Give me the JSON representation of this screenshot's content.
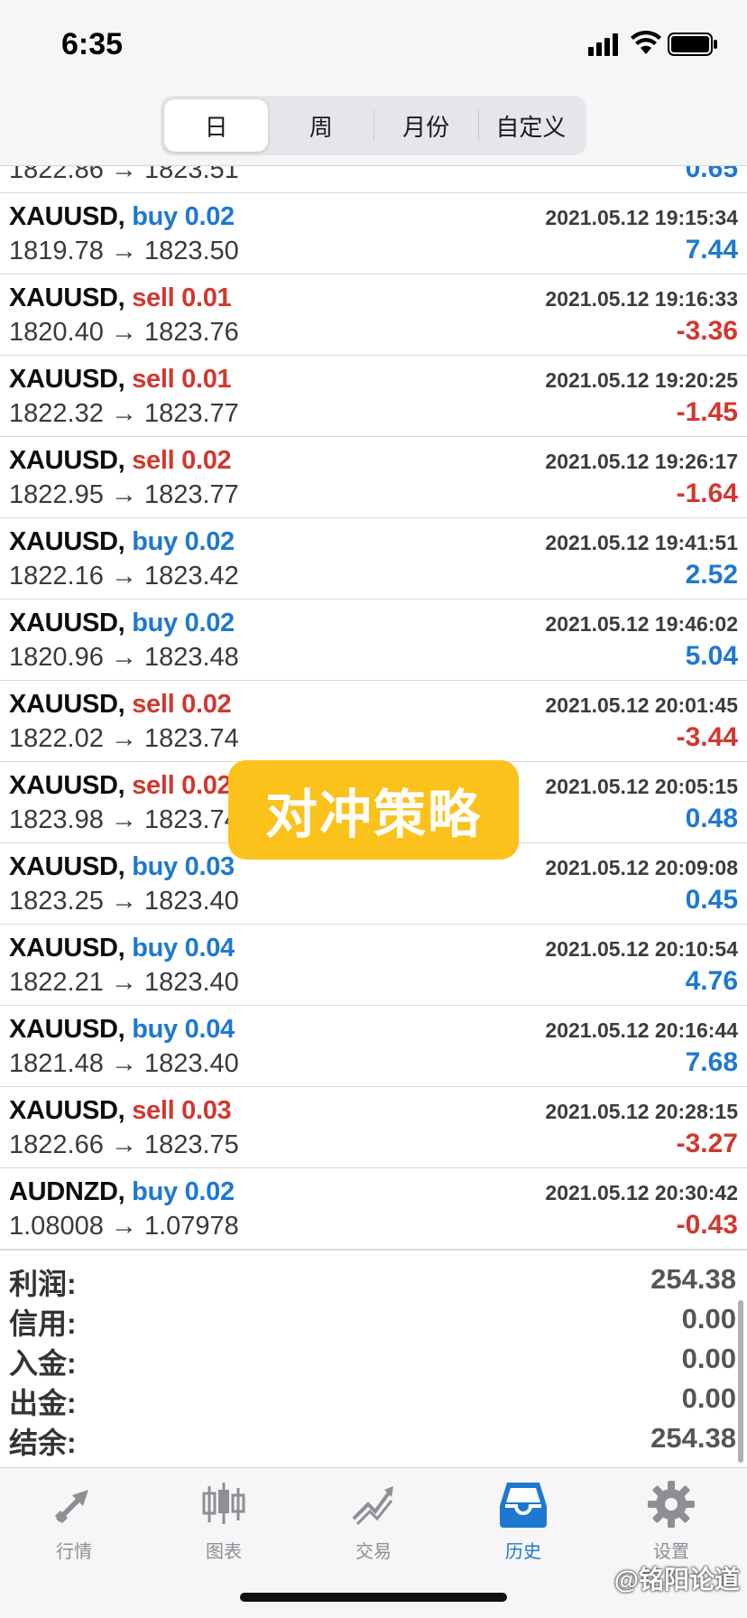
{
  "status": {
    "time": "6:35"
  },
  "periods": [
    "日",
    "周",
    "月份",
    "自定义"
  ],
  "partial_row": {
    "prices": "1822.86 → 1823.51",
    "profit": "0.65"
  },
  "deals": [
    {
      "symbol": "XAUUSD,",
      "side": "buy",
      "volume": "0.02",
      "time": "2021.05.12 19:15:34",
      "prices": "1819.78 → 1823.50",
      "profit": "7.44",
      "sign": "pos"
    },
    {
      "symbol": "XAUUSD,",
      "side": "sell",
      "volume": "0.01",
      "time": "2021.05.12 19:16:33",
      "prices": "1820.40 → 1823.76",
      "profit": "-3.36",
      "sign": "neg"
    },
    {
      "symbol": "XAUUSD,",
      "side": "sell",
      "volume": "0.01",
      "time": "2021.05.12 19:20:25",
      "prices": "1822.32 → 1823.77",
      "profit": "-1.45",
      "sign": "neg"
    },
    {
      "symbol": "XAUUSD,",
      "side": "sell",
      "volume": "0.02",
      "time": "2021.05.12 19:26:17",
      "prices": "1822.95 → 1823.77",
      "profit": "-1.64",
      "sign": "neg"
    },
    {
      "symbol": "XAUUSD,",
      "side": "buy",
      "volume": "0.02",
      "time": "2021.05.12 19:41:51",
      "prices": "1822.16 → 1823.42",
      "profit": "2.52",
      "sign": "pos"
    },
    {
      "symbol": "XAUUSD,",
      "side": "buy",
      "volume": "0.02",
      "time": "2021.05.12 19:46:02",
      "prices": "1820.96 → 1823.48",
      "profit": "5.04",
      "sign": "pos"
    },
    {
      "symbol": "XAUUSD,",
      "side": "sell",
      "volume": "0.02",
      "time": "2021.05.12 20:01:45",
      "prices": "1822.02 → 1823.74",
      "profit": "-3.44",
      "sign": "neg"
    },
    {
      "symbol": "XAUUSD,",
      "side": "sell",
      "volume": "0.02",
      "time": "2021.05.12 20:05:15",
      "prices": "1823.98 → 1823.74",
      "profit": "0.48",
      "sign": "pos"
    },
    {
      "symbol": "XAUUSD,",
      "side": "buy",
      "volume": "0.03",
      "time": "2021.05.12 20:09:08",
      "prices": "1823.25 → 1823.40",
      "profit": "0.45",
      "sign": "pos"
    },
    {
      "symbol": "XAUUSD,",
      "side": "buy",
      "volume": "0.04",
      "time": "2021.05.12 20:10:54",
      "prices": "1822.21 → 1823.40",
      "profit": "4.76",
      "sign": "pos"
    },
    {
      "symbol": "XAUUSD,",
      "side": "buy",
      "volume": "0.04",
      "time": "2021.05.12 20:16:44",
      "prices": "1821.48 → 1823.40",
      "profit": "7.68",
      "sign": "pos"
    },
    {
      "symbol": "XAUUSD,",
      "side": "sell",
      "volume": "0.03",
      "time": "2021.05.12 20:28:15",
      "prices": "1822.66 → 1823.75",
      "profit": "-3.27",
      "sign": "neg"
    },
    {
      "symbol": "AUDNZD,",
      "side": "buy",
      "volume": "0.02",
      "time": "2021.05.12 20:30:42",
      "prices": "1.08008 → 1.07978",
      "profit": "-0.43",
      "sign": "neg"
    }
  ],
  "summary": [
    {
      "label": "利润:",
      "value": "254.38"
    },
    {
      "label": "信用:",
      "value": "0.00"
    },
    {
      "label": "入金:",
      "value": "0.00"
    },
    {
      "label": "出金:",
      "value": "0.00"
    },
    {
      "label": "结余:",
      "value": "254.38"
    }
  ],
  "banner": {
    "text": "对冲策略"
  },
  "tabs": [
    {
      "label": "行情",
      "icon": "quotes-icon"
    },
    {
      "label": "图表",
      "icon": "chart-icon"
    },
    {
      "label": "交易",
      "icon": "trade-icon"
    },
    {
      "label": "历史",
      "icon": "history-icon",
      "active": true
    },
    {
      "label": "设置",
      "icon": "settings-icon"
    }
  ],
  "watermark": {
    "text": "@铭阳论道"
  },
  "colors": {
    "buy": "#1e78d2",
    "sell": "#d2372d",
    "banner": "#fcc21c",
    "active_tab": "#1e78d2"
  }
}
